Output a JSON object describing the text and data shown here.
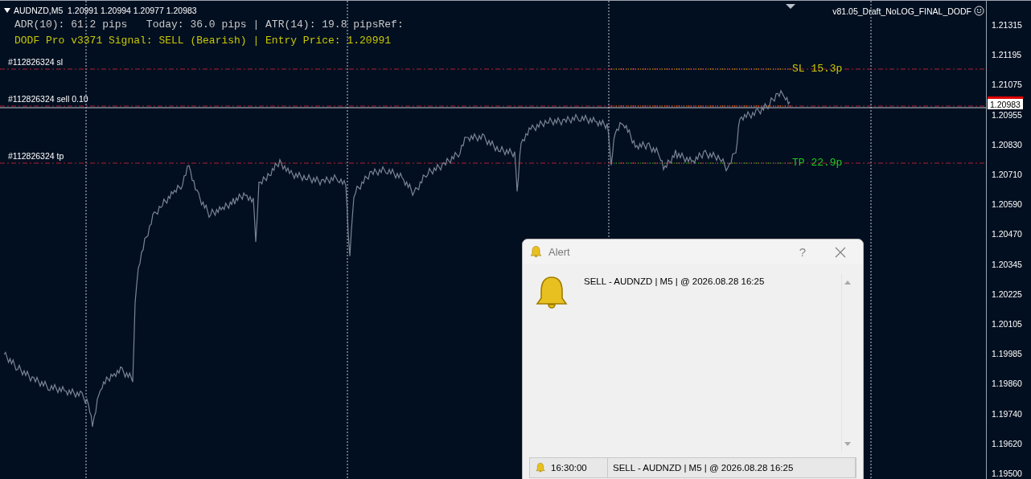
{
  "chart": {
    "symbol_header": "AUDNZD,M5  1.20991 1.20994 1.20977 1.20983",
    "indicator_lines": [
      {
        "text": "ADR(10): 61.2 pips   Today: 36.0 pips | ATR(14): 19.8 pipsRef:",
        "color": "#c8c8c8"
      },
      {
        "text": "DODF Pro v3371 Signal: SELL (Bearish) | Entry Price: 1.20991",
        "color": "#c8c800"
      }
    ],
    "expert_name": "v81.05_Draft_NoLOG_FINAL_DODF",
    "order_lines": [
      {
        "label": "#112826324 sl",
        "kind": "sl"
      },
      {
        "label": "#112826324 sell 0.10",
        "kind": "entry"
      },
      {
        "label": "#112826324 tp",
        "kind": "tp"
      }
    ],
    "level_labels": [
      {
        "text": "SL 15.3p",
        "kind": "sl"
      },
      {
        "text": "TP 22.9p",
        "kind": "tp"
      }
    ],
    "price_axis": {
      "labels": [
        "1.21315",
        "1.21195",
        "1.21075",
        "1.20955",
        "1.20830",
        "1.20710",
        "1.20590",
        "1.20470",
        "1.20345",
        "1.20225",
        "1.20105",
        "1.19985",
        "1.19860",
        "1.19740",
        "1.19620",
        "1.19500"
      ],
      "current_price": "1.20983"
    }
  },
  "alert_dialog": {
    "title": "Alert",
    "help": "?",
    "message": "SELL - AUDNZD | M5 | @ 2026.08.28 16:25",
    "history": [
      {
        "time": "16:30:00",
        "message": "SELL - AUDNZD | M5 | @ 2026.08.28 16:25"
      }
    ]
  }
}
